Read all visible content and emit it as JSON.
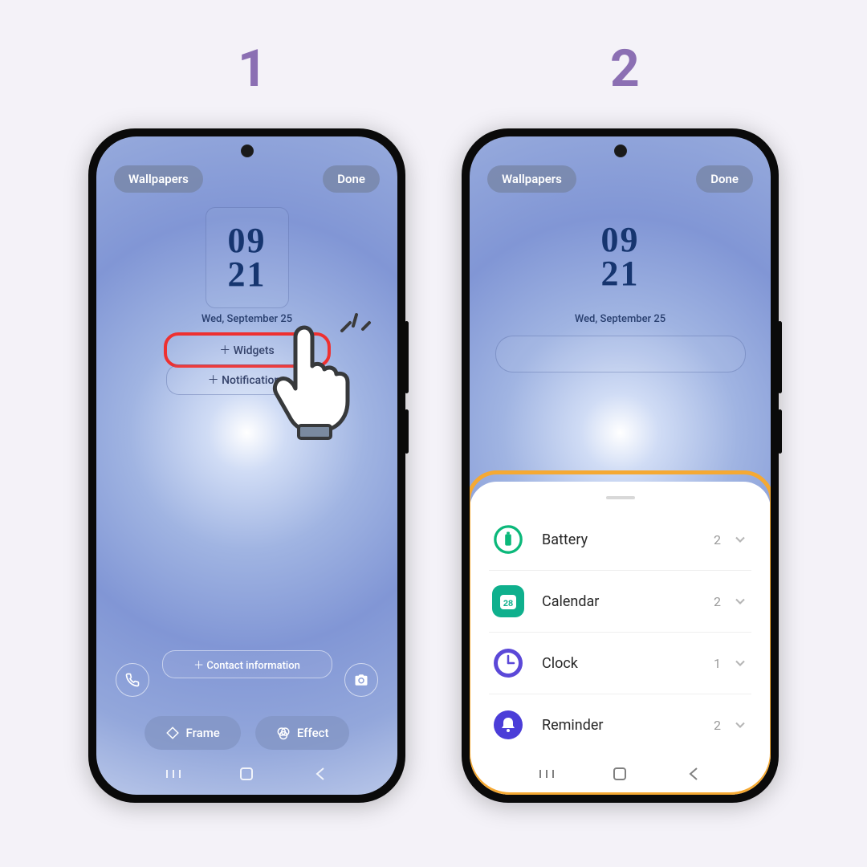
{
  "steps": {
    "one": "1",
    "two": "2"
  },
  "top": {
    "wallpapers": "Wallpapers",
    "done": "Done"
  },
  "clock": {
    "hour": "09",
    "minute": "21",
    "date": "Wed, September 25"
  },
  "buttons": {
    "widgets": "＋  Widgets",
    "notifications": "＋  Notifications",
    "contact": "＋  Contact information"
  },
  "tools": {
    "frame": "Frame",
    "effect": "Effect"
  },
  "widgets": [
    {
      "name": "Battery",
      "count": "2"
    },
    {
      "name": "Calendar",
      "count": "2",
      "cal_day": "28"
    },
    {
      "name": "Clock",
      "count": "1"
    },
    {
      "name": "Reminder",
      "count": "2"
    }
  ]
}
